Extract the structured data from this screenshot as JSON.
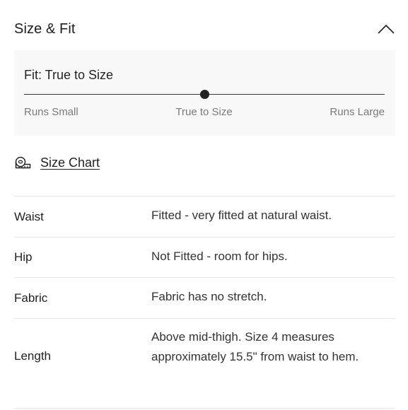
{
  "section": {
    "title": "Size & Fit",
    "toggle_icon": "chevron-up-icon"
  },
  "fit": {
    "title": "Fit: True to Size",
    "scale_labels": [
      "Runs Small",
      "True to Size",
      "Runs Large"
    ],
    "marker_position_fraction": 0.5
  },
  "size_chart": {
    "label": "Size Chart",
    "icon": "measuring-tape-icon"
  },
  "specs": [
    {
      "label": "Waist",
      "value": "Fitted - very fitted at natural waist."
    },
    {
      "label": "Hip",
      "value": "Not Fitted - room for hips."
    },
    {
      "label": "Fabric",
      "value": "Fabric has no stretch."
    },
    {
      "label": "Length",
      "value": "Above mid-thigh. Size 4 measures approximately 15.5\" from waist to hem."
    }
  ],
  "colors": {
    "text": "#222222",
    "muted": "#7b7b7b",
    "panel_bg": "#f8f8f8",
    "divider": "#e6e6e6"
  }
}
